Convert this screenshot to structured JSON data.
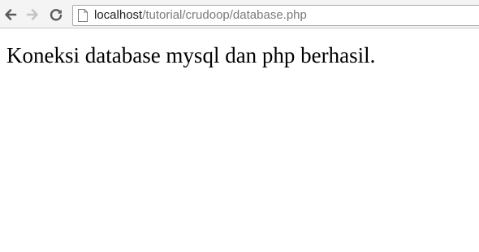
{
  "browser": {
    "address_bar": {
      "host": "localhost",
      "path": "/tutorial/crudoop/database.php"
    },
    "icons": {
      "back": "back-arrow-icon",
      "forward": "forward-arrow-icon",
      "reload": "reload-icon",
      "page": "page-icon"
    }
  },
  "page": {
    "message": "Koneksi database mysql dan php berhasil."
  }
}
